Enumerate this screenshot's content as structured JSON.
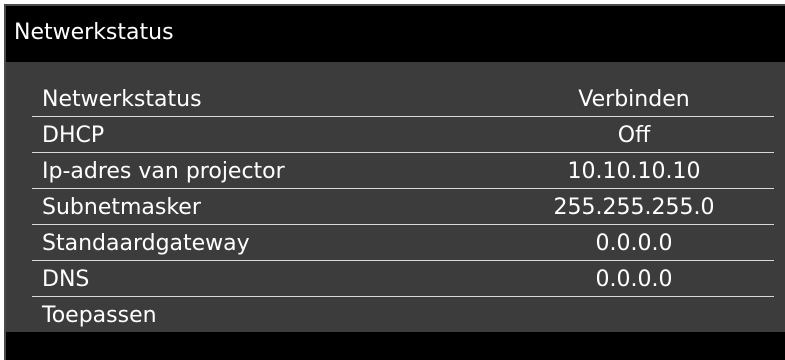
{
  "title": "Netwerkstatus",
  "rows": [
    {
      "label": "Netwerkstatus",
      "value": "Verbinden"
    },
    {
      "label": "DHCP",
      "value": "Off"
    },
    {
      "label": "Ip-adres van projector",
      "value": "10.10.10.10"
    },
    {
      "label": "Subnetmasker",
      "value": "255.255.255.0"
    },
    {
      "label": "Standaardgateway",
      "value": "0.0.0.0"
    },
    {
      "label": "DNS",
      "value": "0.0.0.0"
    },
    {
      "label": "Toepassen",
      "value": ""
    }
  ],
  "colors": {
    "header_bg": "#000000",
    "panel_bg": "#3c3c3c",
    "text": "#ffffff",
    "separator": "#d8d8d8"
  }
}
